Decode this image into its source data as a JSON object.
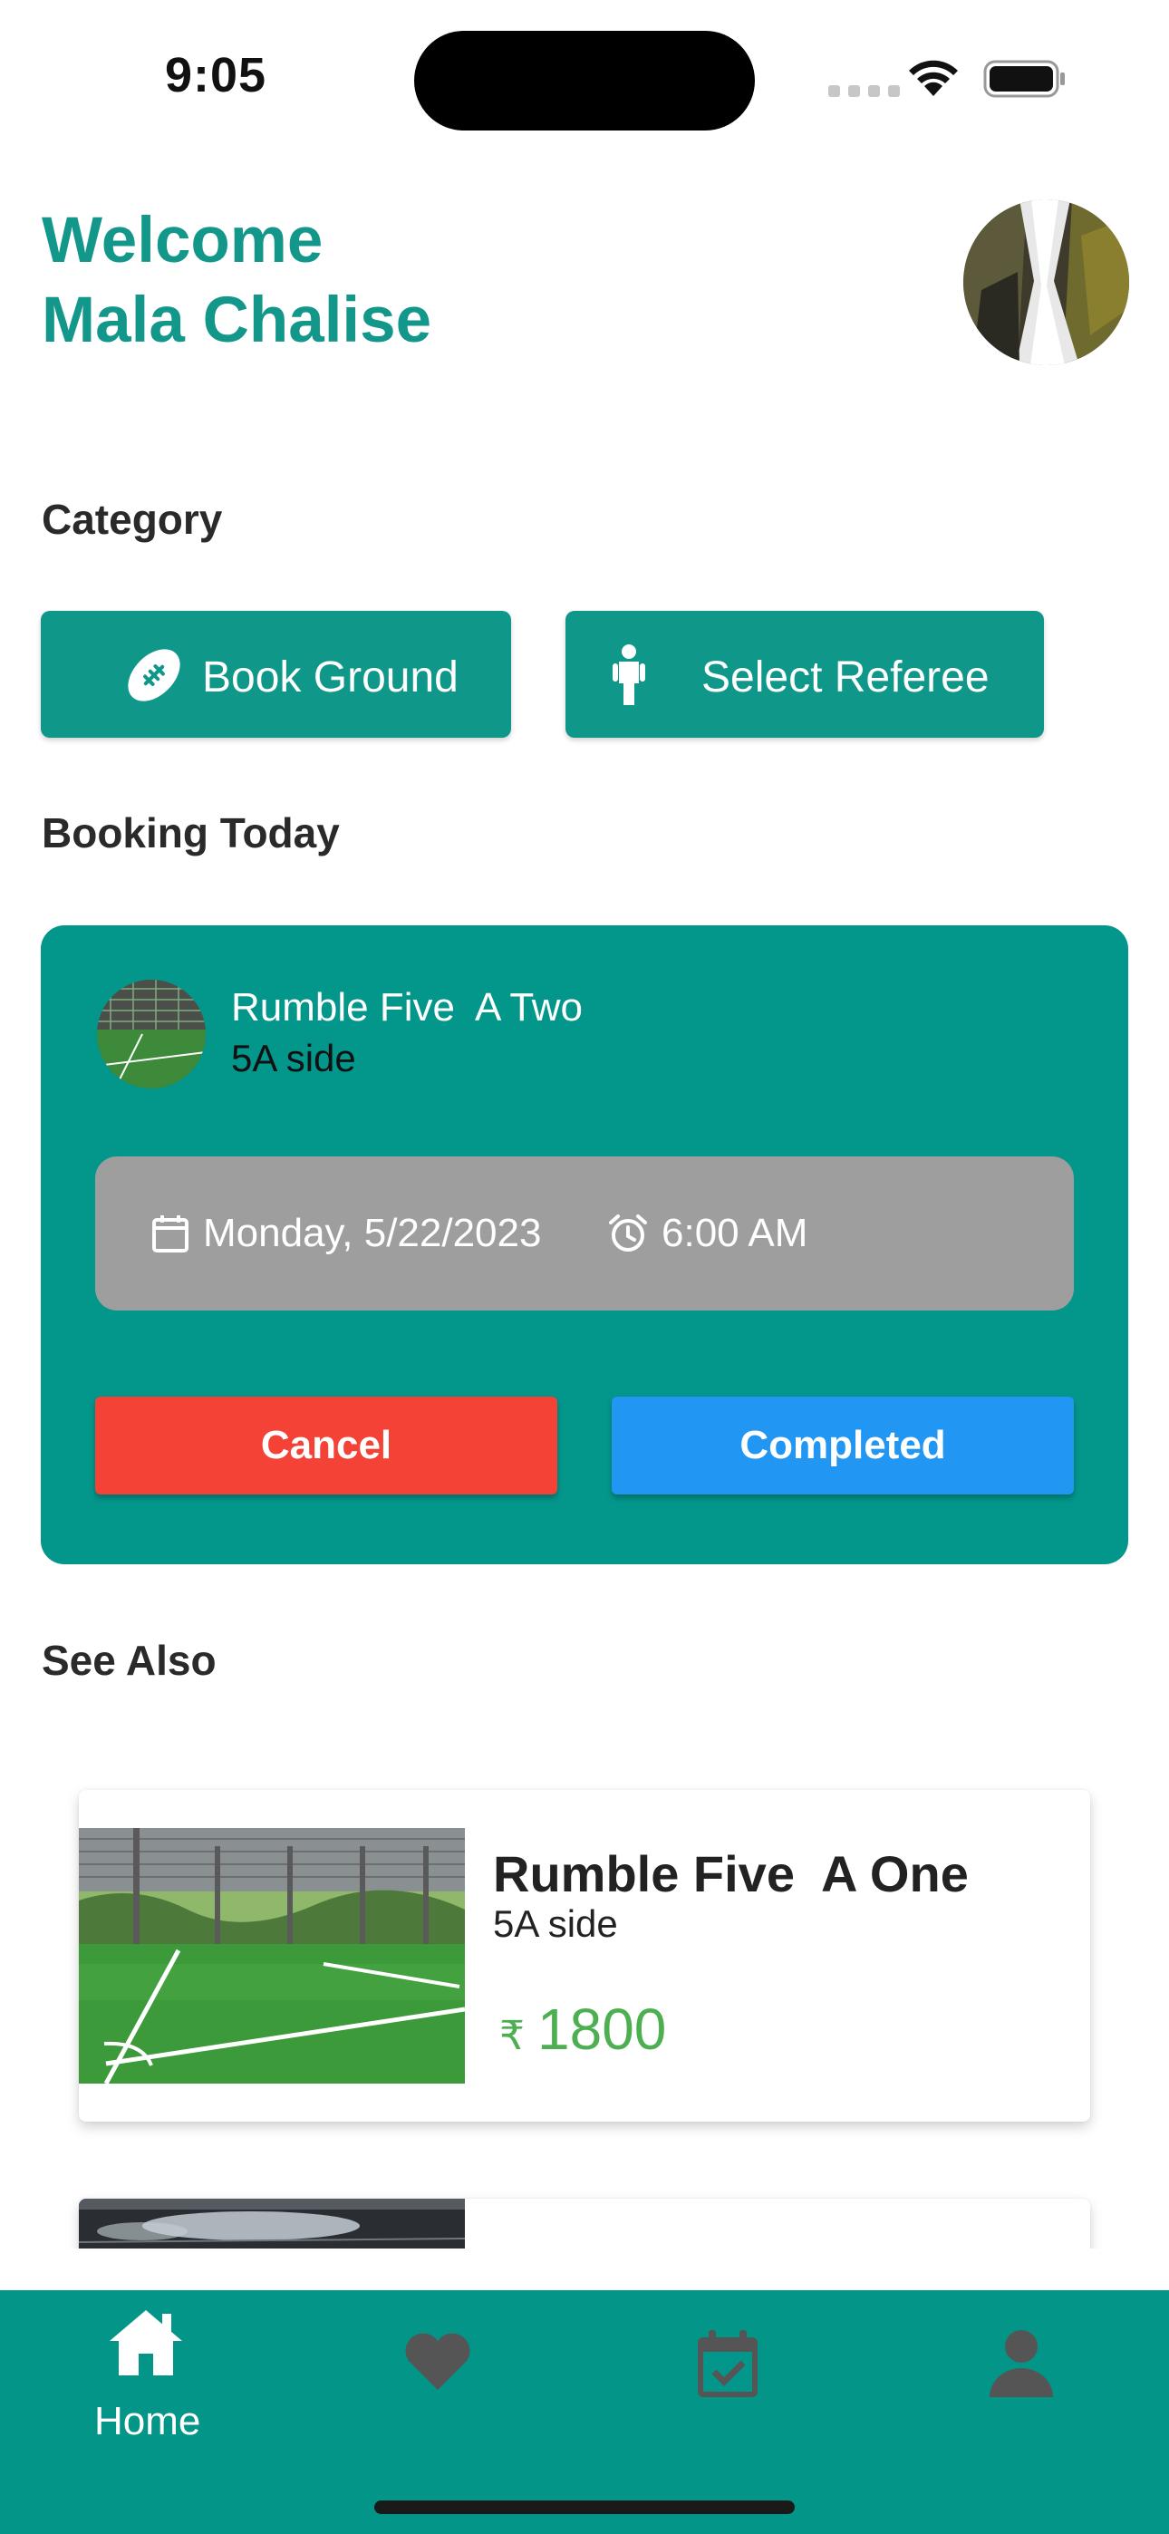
{
  "status_bar": {
    "time": "9:05"
  },
  "header": {
    "welcome_line1": "Welcome",
    "welcome_line2": "Mala Chalise",
    "avatar_icon": "waterfall-photo"
  },
  "category": {
    "title": "Category",
    "buttons": [
      {
        "label": "Book Ground",
        "icon": "football-icon"
      },
      {
        "label": "Select Referee",
        "icon": "person-icon"
      }
    ]
  },
  "booking_today": {
    "title": "Booking Today",
    "venue_name": "Rumble Five  A Two",
    "venue_type": "5A side",
    "date": "Monday, 5/22/2023",
    "time": "6:00 AM",
    "cancel_label": "Cancel",
    "completed_label": "Completed"
  },
  "see_also": {
    "title": "See Also",
    "items": [
      {
        "name": "Rumble Five  A One",
        "type": "5A side",
        "currency": "₹",
        "price": "1800"
      }
    ]
  },
  "bottom_nav": {
    "items": [
      {
        "label": "Home",
        "icon": "home-icon",
        "active": true
      },
      {
        "label": "",
        "icon": "heart-icon",
        "active": false
      },
      {
        "label": "",
        "icon": "calendar-check-icon",
        "active": false
      },
      {
        "label": "",
        "icon": "person-icon",
        "active": false
      }
    ]
  },
  "colors": {
    "primary": "#03968a",
    "cancel": "#f44336",
    "completed": "#2196f3",
    "price": "#4caf50",
    "inactive_icon": "#555555"
  }
}
